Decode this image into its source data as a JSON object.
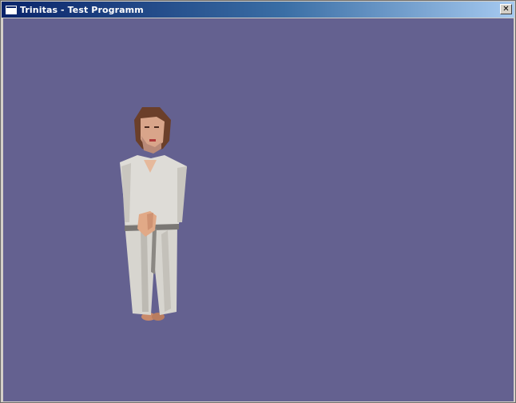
{
  "window": {
    "title": "Trinitas - Test Programm",
    "close_glyph": "✕"
  },
  "scene": {
    "background_color": "#646190",
    "character_icon": "robed-man-character"
  }
}
